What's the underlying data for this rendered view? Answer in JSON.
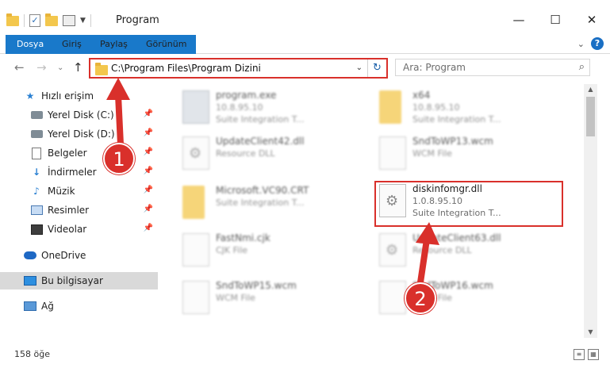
{
  "window": {
    "title": "Program",
    "minimize": "—",
    "maximize": "☐",
    "close": "✕"
  },
  "ribbon": {
    "tabs": [
      "Dosya",
      "Giriş",
      "Paylaş",
      "Görünüm"
    ],
    "collapse": "⌄",
    "help": "?"
  },
  "nav": {
    "back": "←",
    "forward": "→",
    "recent": "⌄",
    "up": "↑",
    "address": "C:\\Program Files\\Program Dizini",
    "address_dropdown": "⌄",
    "refresh": "↻",
    "search_placeholder": "Ara: Program",
    "search_icon": "⌕"
  },
  "sidebar": {
    "items": [
      {
        "label": "Hızlı erişim",
        "icon": "star-icon",
        "pinned": false
      },
      {
        "label": "Yerel Disk (C:)",
        "icon": "disk-icon",
        "pinned": true
      },
      {
        "label": "Yerel Disk (D:)",
        "icon": "disk-icon",
        "pinned": true
      },
      {
        "label": "Belgeler",
        "icon": "document-icon",
        "pinned": true
      },
      {
        "label": "İndirmeler",
        "icon": "download-icon",
        "pinned": true
      },
      {
        "label": "Müzik",
        "icon": "music-icon",
        "pinned": true
      },
      {
        "label": "Resimler",
        "icon": "pictures-icon",
        "pinned": true
      },
      {
        "label": "Videolar",
        "icon": "videos-icon",
        "pinned": true
      },
      {
        "label": "OneDrive",
        "icon": "cloud-icon",
        "pinned": false
      },
      {
        "label": "Bu bilgisayar",
        "icon": "computer-icon",
        "pinned": false,
        "selected": true
      },
      {
        "label": "Ağ",
        "icon": "network-icon",
        "pinned": false
      }
    ]
  },
  "files": [
    {
      "name": "program.exe",
      "line2": "10.8.95.10",
      "line3": "Suite Integration T...",
      "icon": "exe-icon",
      "faded": true
    },
    {
      "name": "x64",
      "line2": "10.8.95.10",
      "line3": "Suite Integration T...",
      "icon": "folder-icon",
      "faded": true
    },
    {
      "name": "UpdateClient42.dll",
      "line2": "Resource DLL",
      "line3": "",
      "icon": "gear-file-icon",
      "faded": true
    },
    {
      "name": "SndToWP13.wcm",
      "line2": "WCM File",
      "line3": "",
      "icon": "document-icon",
      "faded": true
    },
    {
      "name": "Microsoft.VC90.CRT",
      "line2": "Suite Integration T...",
      "line3": "",
      "icon": "folder-icon",
      "faded": true
    },
    {
      "name": "diskinfomgr.dll",
      "line2": "1.0.8.95.10",
      "line3": "Suite Integration T...",
      "icon": "gear-file-icon",
      "faded": false
    },
    {
      "name": "FastNmi.cjk",
      "line2": "CJK File",
      "line3": "",
      "icon": "document-icon",
      "faded": true
    },
    {
      "name": "UpdateClient63.dll",
      "line2": "Resource DLL",
      "line3": "",
      "icon": "gear-file-icon",
      "faded": true
    },
    {
      "name": "SndToWP15.wcm",
      "line2": "WCM File",
      "line3": "",
      "icon": "document-icon",
      "faded": true
    },
    {
      "name": "SndToWP16.wcm",
      "line2": "WCM File",
      "line3": "",
      "icon": "document-icon",
      "faded": true
    }
  ],
  "status": {
    "item_count": "158 öğe"
  },
  "annotations": {
    "step1": "1",
    "step2": "2",
    "color": "#d9302b"
  }
}
